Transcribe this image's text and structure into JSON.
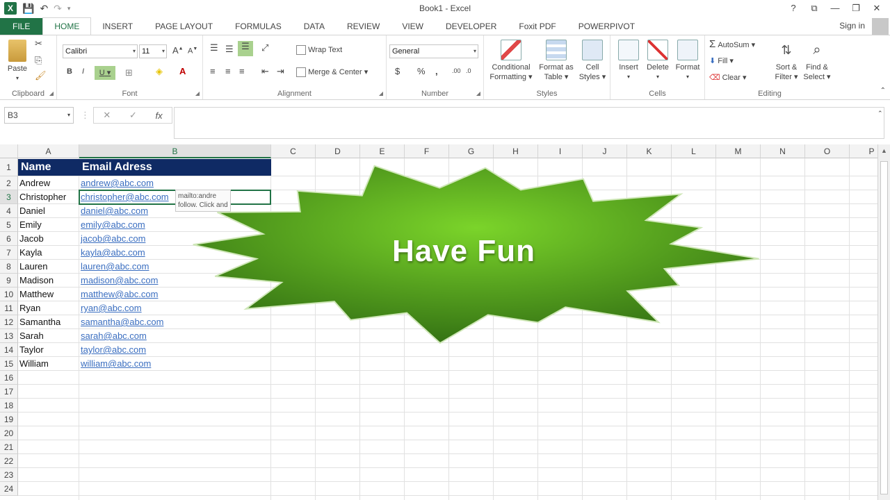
{
  "window": {
    "title": "Book1 - Excel",
    "controls": [
      "?",
      "⧉",
      "—",
      "❐",
      "✕"
    ]
  },
  "qat": {
    "undo": "↶",
    "redo": "↷"
  },
  "tabs": [
    "FILE",
    "HOME",
    "INSERT",
    "PAGE LAYOUT",
    "FORMULAS",
    "DATA",
    "REVIEW",
    "VIEW",
    "DEVELOPER",
    "Foxit PDF",
    "POWERPIVOT"
  ],
  "active_tab": "HOME",
  "signin": "Sign in",
  "ribbon": {
    "clipboard": {
      "label": "Clipboard",
      "paste": "Paste"
    },
    "font": {
      "label": "Font",
      "font_name": "Calibri",
      "font_size": "11",
      "bold": "B",
      "italic": "I",
      "underline": "U"
    },
    "alignment": {
      "label": "Alignment",
      "wrap": "Wrap Text",
      "merge": "Merge & Center"
    },
    "number": {
      "label": "Number",
      "format": "General",
      "currency": "$",
      "percent": "%",
      "comma": ","
    },
    "styles": {
      "label": "Styles",
      "cond1": "Conditional",
      "cond2": "Formatting",
      "fmt1": "Format as",
      "fmt2": "Table",
      "cell1": "Cell",
      "cell2": "Styles"
    },
    "cells": {
      "label": "Cells",
      "insert": "Insert",
      "delete": "Delete",
      "format": "Format"
    },
    "editing": {
      "label": "Editing",
      "autosum": "AutoSum",
      "fill": "Fill",
      "clear": "Clear",
      "sort1": "Sort &",
      "sort2": "Filter",
      "find1": "Find &",
      "find2": "Select"
    }
  },
  "formula_bar": {
    "name_box": "B3",
    "cancel": "✕",
    "enter": "✓",
    "fx": "fx",
    "value": ""
  },
  "columns": [
    "A",
    "B",
    "C",
    "D",
    "E",
    "F",
    "G",
    "H",
    "I",
    "J",
    "K",
    "L",
    "M",
    "N",
    "O",
    "P"
  ],
  "rows": [
    "1",
    "2",
    "3",
    "4",
    "5",
    "6",
    "7",
    "8",
    "9",
    "10",
    "11",
    "12",
    "13",
    "14",
    "15",
    "16",
    "17",
    "18",
    "19",
    "20",
    "21",
    "22",
    "23",
    "24"
  ],
  "table": {
    "headers": [
      "Name",
      "Email Adress"
    ],
    "data": [
      [
        "Andrew",
        "andrew@abc.com"
      ],
      [
        "Christopher",
        "christopher@abc.com"
      ],
      [
        "Daniel",
        "daniel@abc.com"
      ],
      [
        "Emily",
        "emily@abc.com"
      ],
      [
        "Jacob",
        "jacob@abc.com"
      ],
      [
        "Kayla",
        "kayla@abc.com"
      ],
      [
        "Lauren",
        "lauren@abc.com"
      ],
      [
        "Madison",
        "madison@abc.com"
      ],
      [
        "Matthew",
        "matthew@abc.com"
      ],
      [
        "Ryan",
        "ryan@abc.com"
      ],
      [
        "Samantha",
        "samantha@abc.com"
      ],
      [
        "Sarah",
        "sarah@abc.com"
      ],
      [
        "Taylor",
        "taylor@abc.com"
      ],
      [
        "William",
        "william@abc.com"
      ]
    ]
  },
  "tooltip": {
    "line1": "mailto:andre",
    "line2": "follow. Click and"
  },
  "shape": {
    "text": "Have Fun"
  },
  "colors": {
    "excel_green": "#217346",
    "header_fill": "#0f2a64",
    "star_light": "#7bd42a",
    "star_dark": "#2f6b12",
    "link": "#3a6ec0"
  }
}
